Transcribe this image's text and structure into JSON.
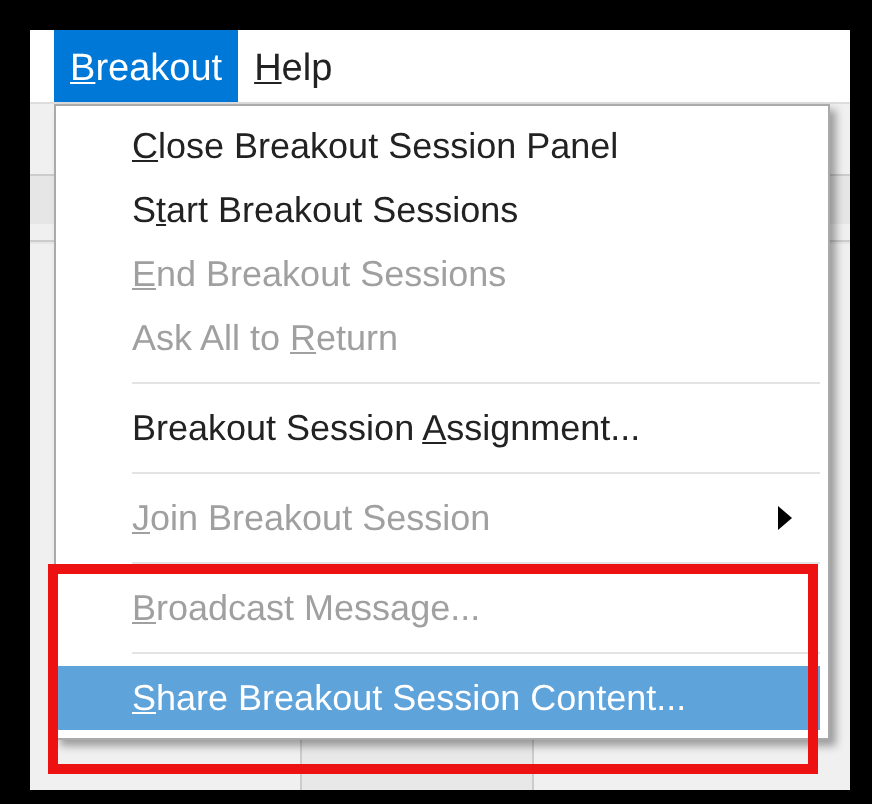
{
  "menu_bar": [
    {
      "access_key": "B",
      "label_end": "reakout",
      "selected": true
    },
    {
      "access_key": "H",
      "label_end": "elp",
      "selected": false
    }
  ],
  "menu": {
    "items": [
      {
        "kind": "item",
        "access_key": "C",
        "label_end": "lose Breakout Session Panel",
        "disabled": false,
        "selected": false
      },
      {
        "kind": "item",
        "label_start": "S",
        "access_key": "t",
        "label_end": "art Breakout Sessions",
        "disabled": false,
        "selected": false
      },
      {
        "kind": "item",
        "access_key": "E",
        "label_end": "nd Breakout Sessions",
        "disabled": true,
        "selected": false
      },
      {
        "kind": "item",
        "label_start": "Ask All to ",
        "access_key": "R",
        "label_end": "eturn",
        "disabled": true,
        "selected": false
      },
      {
        "kind": "separator"
      },
      {
        "kind": "item",
        "label_start": "Breakout Session ",
        "access_key": "A",
        "label_end": "ssignment...",
        "disabled": false,
        "selected": false
      },
      {
        "kind": "separator"
      },
      {
        "kind": "submenu",
        "access_key": "J",
        "label_end": "oin Breakout Session",
        "disabled": true,
        "selected": false
      },
      {
        "kind": "separator"
      },
      {
        "kind": "item",
        "access_key": "B",
        "label_end": "roadcast Message...",
        "disabled": true,
        "selected": false
      },
      {
        "kind": "separator"
      },
      {
        "kind": "item",
        "access_key": "S",
        "label_end": "hare Breakout Session Content...",
        "disabled": false,
        "selected": true
      }
    ]
  }
}
